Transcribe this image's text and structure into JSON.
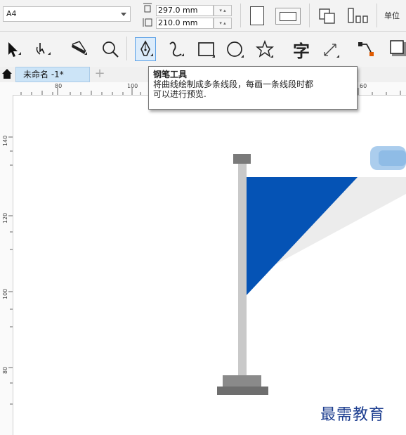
{
  "property_bar": {
    "paper_size": "A4",
    "height_value": "297.0 mm",
    "width_value": "210.0 mm",
    "units_label": "单位"
  },
  "toolbox": {
    "tools": [
      {
        "name": "pick-tool",
        "icon": "arrow-icon"
      },
      {
        "name": "shape-tool",
        "icon": "node-icon"
      },
      {
        "name": "crop-tool",
        "icon": "knife-icon"
      },
      {
        "name": "zoom-tool",
        "icon": "magnifier-icon"
      },
      {
        "name": "pen-tool",
        "icon": "pen-nib-icon",
        "active": true
      },
      {
        "name": "bspline-tool",
        "icon": "curve-icon"
      },
      {
        "name": "rectangle-tool",
        "icon": "rectangle-icon"
      },
      {
        "name": "ellipse-tool",
        "icon": "ellipse-icon"
      },
      {
        "name": "polygon-tool",
        "icon": "star-icon"
      },
      {
        "name": "text-tool",
        "icon": "text-char-icon",
        "glyph": "字"
      },
      {
        "name": "dimension-tool",
        "icon": "dimension-icon"
      },
      {
        "name": "connector-tool",
        "icon": "connector-icon"
      },
      {
        "name": "shadow-tool",
        "icon": "shadow-icon"
      }
    ]
  },
  "tabs": {
    "document_tab": "未命名 -1*",
    "add_tab": "+"
  },
  "ruler": {
    "h_labels": [
      "80",
      "100",
      "60"
    ],
    "v_labels": [
      "140",
      "120",
      "100",
      "80"
    ]
  },
  "tooltip": {
    "title": "钢笔工具",
    "line1": "将曲线绘制成多条线段，每画一条线段时都",
    "line2": "可以进行预览."
  },
  "watermark": "最需教育",
  "colors": {
    "flag": "#0553b5",
    "pole": "#c9c9c9",
    "cap": "#7a7a7a",
    "tool_active": "#dcecfb"
  }
}
